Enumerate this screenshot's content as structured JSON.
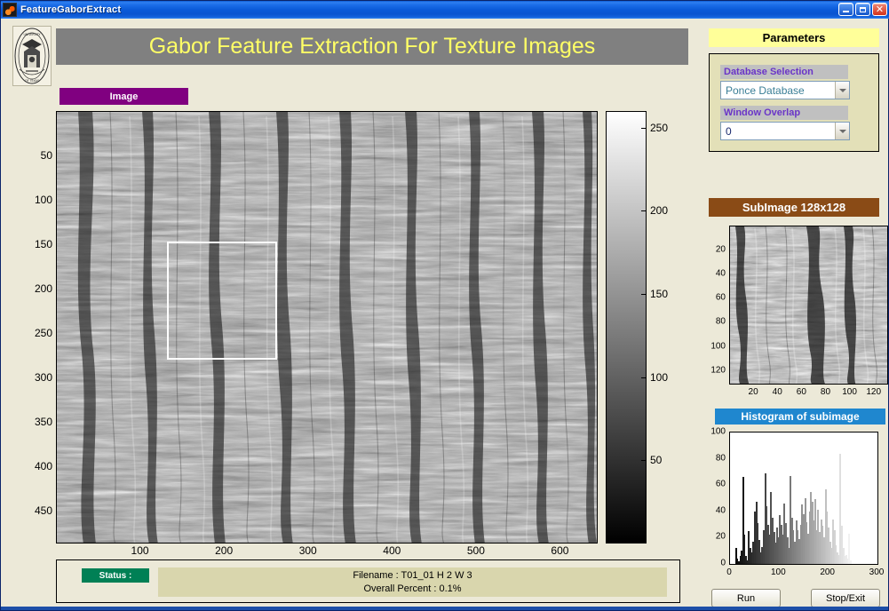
{
  "window": {
    "title": "FeatureGaborExtract",
    "icon": "matlab-icon",
    "buttons": {
      "minimize": "_",
      "maximize": "□",
      "close": "✕"
    }
  },
  "header": {
    "title": "Gabor Feature Extraction For Texture Images",
    "title_color": "#ffff66",
    "title_bg": "#808080",
    "logo": "university-seal"
  },
  "image_panel": {
    "label": "Image",
    "label_bg": "#800080",
    "yticks": [
      "50",
      "100",
      "150",
      "200",
      "250",
      "300",
      "350",
      "400",
      "450"
    ],
    "xticks": [
      "100",
      "200",
      "300",
      "400",
      "500",
      "600"
    ],
    "selection_box": "subimage-selection"
  },
  "colorbar": {
    "ticks": [
      "250",
      "200",
      "150",
      "100",
      "50"
    ],
    "min": 0,
    "max": 260
  },
  "status": {
    "badge": "Status :",
    "badge_bg": "#008055",
    "line1": "Filename : T01_01   H 2   W 3",
    "line2": "Overall Percent : 0.1%"
  },
  "parameters": {
    "header": "Parameters",
    "header_bg": "#ffff99",
    "database": {
      "label": "Database Selection",
      "value": "Ponce Database",
      "value_color": "#3a7e96"
    },
    "overlap": {
      "label": "Window Overlap",
      "value": "0",
      "value_color": "#1a2a6e"
    }
  },
  "subimage": {
    "header": "SubImage 128x128",
    "header_bg": "#8a4b16",
    "yticks": [
      "20",
      "40",
      "60",
      "80",
      "100",
      "120"
    ],
    "xticks": [
      "20",
      "40",
      "60",
      "80",
      "100",
      "120"
    ]
  },
  "histogram": {
    "header": "Histogram of subimage",
    "header_bg": "#1f87cf"
  },
  "actions": {
    "run": "Run",
    "stop": "Stop/Exit"
  },
  "chart_data": {
    "type": "bar",
    "title": "Histogram of subimage",
    "xlabel": "",
    "ylabel": "",
    "xlim": [
      0,
      300
    ],
    "ylim": [
      0,
      100
    ],
    "xticks": [
      0,
      100,
      200,
      300
    ],
    "yticks": [
      0,
      20,
      40,
      60,
      80,
      100
    ],
    "grid": false,
    "legend": null,
    "x": [
      10,
      13,
      16,
      19,
      22,
      25,
      28,
      31,
      34,
      37,
      40,
      43,
      46,
      49,
      52,
      55,
      58,
      61,
      64,
      67,
      70,
      73,
      76,
      79,
      82,
      85,
      88,
      91,
      94,
      97,
      100,
      103,
      106,
      109,
      112,
      115,
      118,
      121,
      124,
      127,
      130,
      133,
      136,
      139,
      142,
      145,
      148,
      151,
      154,
      157,
      160,
      163,
      166,
      169,
      172,
      175,
      178,
      181,
      184,
      187,
      190,
      193,
      196,
      199,
      202,
      205,
      208,
      211,
      214,
      217,
      220,
      223,
      226,
      229,
      232,
      235,
      238,
      241,
      244
    ],
    "values": [
      12,
      4,
      2,
      6,
      10,
      66,
      22,
      6,
      3,
      25,
      12,
      9,
      17,
      40,
      47,
      31,
      18,
      9,
      13,
      26,
      69,
      44,
      30,
      22,
      55,
      35,
      24,
      16,
      28,
      20,
      37,
      30,
      22,
      46,
      31,
      20,
      12,
      67,
      35,
      26,
      17,
      33,
      26,
      19,
      30,
      45,
      38,
      50,
      32,
      23,
      40,
      55,
      47,
      33,
      49,
      26,
      41,
      24,
      34,
      29,
      20,
      57,
      40,
      28,
      17,
      12,
      34,
      26,
      14,
      9,
      7,
      84,
      29,
      12,
      6,
      7,
      4,
      23,
      3
    ]
  }
}
